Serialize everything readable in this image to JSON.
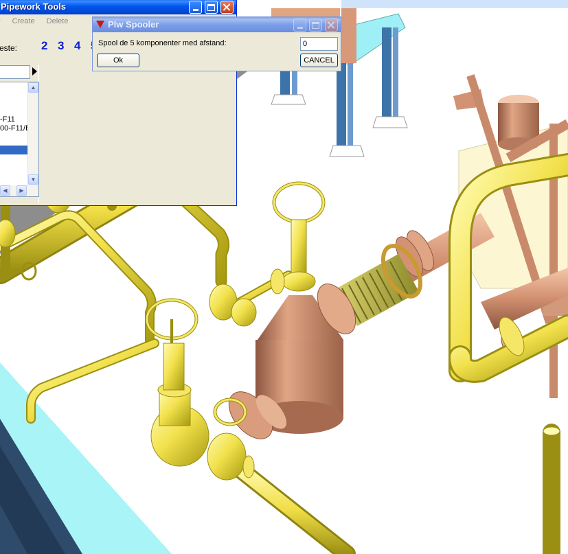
{
  "pipework_tools": {
    "title": "Pipework Tools",
    "menu": [
      "y",
      "Create",
      "Delete"
    ],
    "label": "este:",
    "numbers": [
      "2",
      "3",
      "4",
      "5"
    ],
    "list_items": [
      "-F11",
      "00-F11/B"
    ],
    "scroll_up": "▲",
    "scroll_down": "▼",
    "scroll_left": "◀",
    "scroll_right": "▶"
  },
  "spooler": {
    "title": "Plw Spooler",
    "prompt": "Spool de 5 komponenter med afstand:",
    "value": "0",
    "ok_label": "Ok",
    "cancel_label": "CANCEL"
  },
  "colors": {
    "pipe_yellow": "#f2e14c",
    "copper": "#c98a6c",
    "steel_blue": "#3c73a8",
    "cyan_floor": "#a8f4f6",
    "xp_blue": "#0058ee"
  }
}
